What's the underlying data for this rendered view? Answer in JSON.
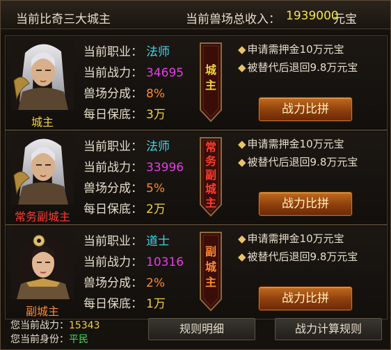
{
  "header": {
    "title": "当前比奇三大城主",
    "income_label": "当前兽场总收入：",
    "income_value": "1939000",
    "income_unit": "元宝"
  },
  "labels": {
    "job": "当前职业：",
    "power": "当前战力：",
    "share": "兽场分成：",
    "daily": "每日保底："
  },
  "panels": [
    {
      "role_tag": "城主",
      "role_tag_color": "#f2d33c",
      "badge_chars": [
        "城",
        "主"
      ],
      "badge_color": "#f2d33c",
      "job": "法师",
      "job_color": "#3fd6e8",
      "power": "34695",
      "share": "8%",
      "daily": "3万",
      "note1": "申请需押金10万元宝",
      "note2": "被替代后退回9.8万元宝",
      "button": "战力比拼"
    },
    {
      "role_tag": "常务副城主",
      "role_tag_color": "#ff3b2f",
      "badge_chars": [
        "常",
        "务",
        "副",
        "城",
        "主"
      ],
      "badge_color": "#ff3b2f",
      "job": "法师",
      "job_color": "#3fd6e8",
      "power": "33996",
      "share": "5%",
      "daily": "2万",
      "note1": "申请需押金10万元宝",
      "note2": "被替代后退回9.8万元宝",
      "button": "战力比拼"
    },
    {
      "role_tag": "副城主",
      "role_tag_color": "#ff8a2e",
      "badge_chars": [
        "副",
        "城",
        "主"
      ],
      "badge_color": "#ff8a2e",
      "job": "道士",
      "job_color": "#3fd6e8",
      "power": "10316",
      "share": "2%",
      "daily": "1万",
      "note1": "申请需押金10万元宝",
      "note2": "被替代后退回9.8万元宝",
      "button": "战力比拼"
    }
  ],
  "colors": {
    "power": "#e83be8",
    "share": "#ff8a2e",
    "daily": "#f2d33c",
    "my_power": "#f2d33c",
    "my_status": "#3fe05a"
  },
  "footer": {
    "my_power_label": "您当前战力：",
    "my_power_value": "15343",
    "my_status_label": "您当前身份：",
    "my_status_value": "平民",
    "rules_button": "规则明细",
    "calc_button": "战力计算规则"
  }
}
